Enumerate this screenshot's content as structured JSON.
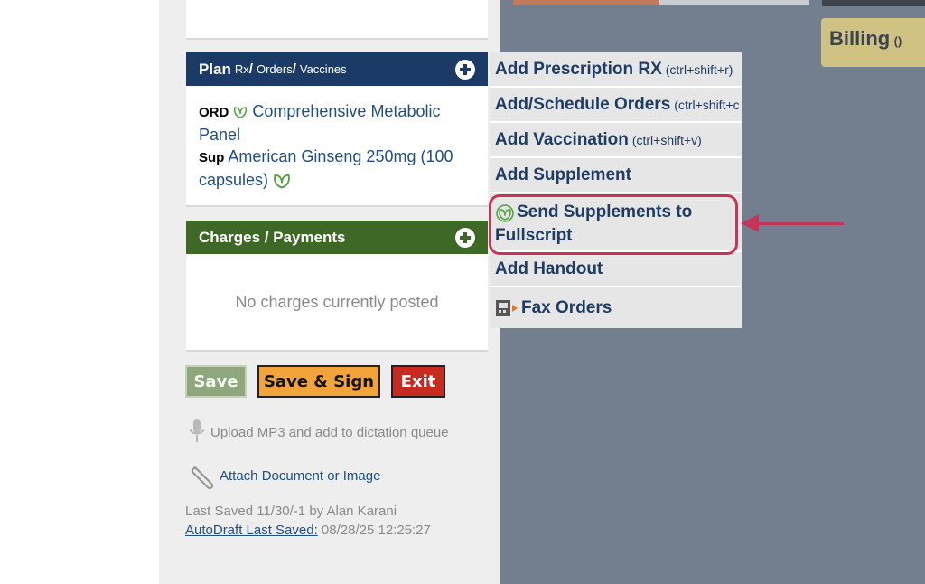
{
  "billing": {
    "label": "Billing",
    "count": "()"
  },
  "plan": {
    "title": "Plan",
    "subtitle_rx": "Rx",
    "subtitle_orders": "Orders",
    "subtitle_vaccines": "Vaccines",
    "slash": "/",
    "items": [
      {
        "tag": "ORD",
        "text": "Comprehensive Metabolic Panel"
      },
      {
        "tag": "Sup",
        "text": "American Ginseng 250mg (100 capsules)"
      }
    ]
  },
  "charges": {
    "title": "Charges / Payments",
    "empty_text": "No charges currently posted"
  },
  "buttons": {
    "save": "Save",
    "save_sign": "Save & Sign",
    "exit": "Exit"
  },
  "upload_text": "Upload MP3 and add to dictation queue",
  "attach_text": "Attach Document or Image",
  "last_saved": {
    "text": "Last Saved 11/30/-1 by Alan Karani",
    "autodraft_label": "AutoDraft Last Saved:",
    "autodraft_value": "08/28/25 12:25:27"
  },
  "menu": {
    "add_rx": {
      "label": "Add Prescription RX",
      "shortcut": "(ctrl+shift+r)"
    },
    "add_orders": {
      "label": "Add/Schedule Orders",
      "shortcut": "(ctrl+shift+c"
    },
    "add_vaccination": {
      "label": "Add Vaccination",
      "shortcut": "(ctrl+shift+v)"
    },
    "add_supplement": {
      "label": "Add Supplement"
    },
    "send_fullscript": {
      "label": "Send Supplements to Fullscript"
    },
    "add_handout": {
      "label": "Add Handout"
    },
    "fax_orders": {
      "label": "Fax Orders"
    }
  },
  "colors": {
    "plan_header": "#1b3b66",
    "charges_header": "#3e6826",
    "highlight": "#c5355a",
    "menu_text": "#1e3c64",
    "leaf_green": "#5aa646"
  }
}
